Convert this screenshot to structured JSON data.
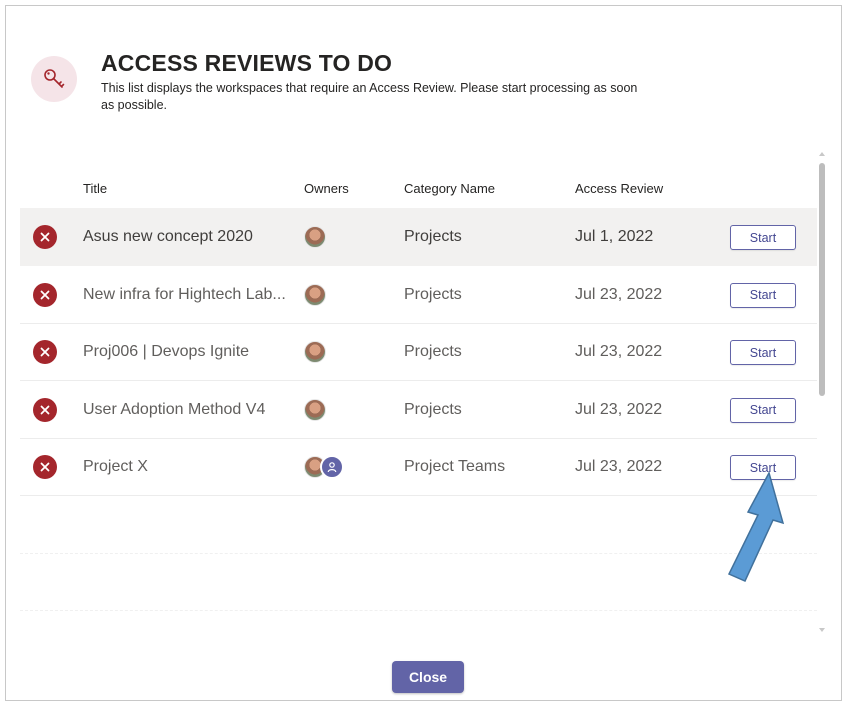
{
  "dialog": {
    "title": "ACCESS REVIEWS TO DO",
    "description": "This list displays the workspaces that require an Access Review. Please start processing as soon as possible.",
    "header_icon": "key-icon",
    "close_label": "Close"
  },
  "table": {
    "columns": {
      "title": "Title",
      "owners": "Owners",
      "category": "Category Name",
      "access_review": "Access Review"
    },
    "rows": [
      {
        "title": "Asus new concept 2020",
        "category": "Projects",
        "access_review": "Jul 1, 2022",
        "start_label": "Start",
        "owners": [
          "photo"
        ]
      },
      {
        "title": "New infra for Hightech Lab...",
        "category": "Projects",
        "access_review": "Jul 23, 2022",
        "start_label": "Start",
        "owners": [
          "photo"
        ]
      },
      {
        "title": "Proj006 | Devops Ignite",
        "category": "Projects",
        "access_review": "Jul 23, 2022",
        "start_label": "Start",
        "owners": [
          "photo"
        ]
      },
      {
        "title": "User Adoption Method V4",
        "category": "Projects",
        "access_review": "Jul 23, 2022",
        "start_label": "Start",
        "owners": [
          "photo"
        ]
      },
      {
        "title": "Project X",
        "category": "Project Teams",
        "access_review": "Jul 23, 2022",
        "start_label": "Start",
        "owners": [
          "photo",
          "person-icon"
        ]
      }
    ]
  },
  "colors": {
    "accent": "#6264a7",
    "status_red": "#a4262c",
    "icon_bg": "#f5e4e8",
    "arrow": "#5b9bd5"
  }
}
